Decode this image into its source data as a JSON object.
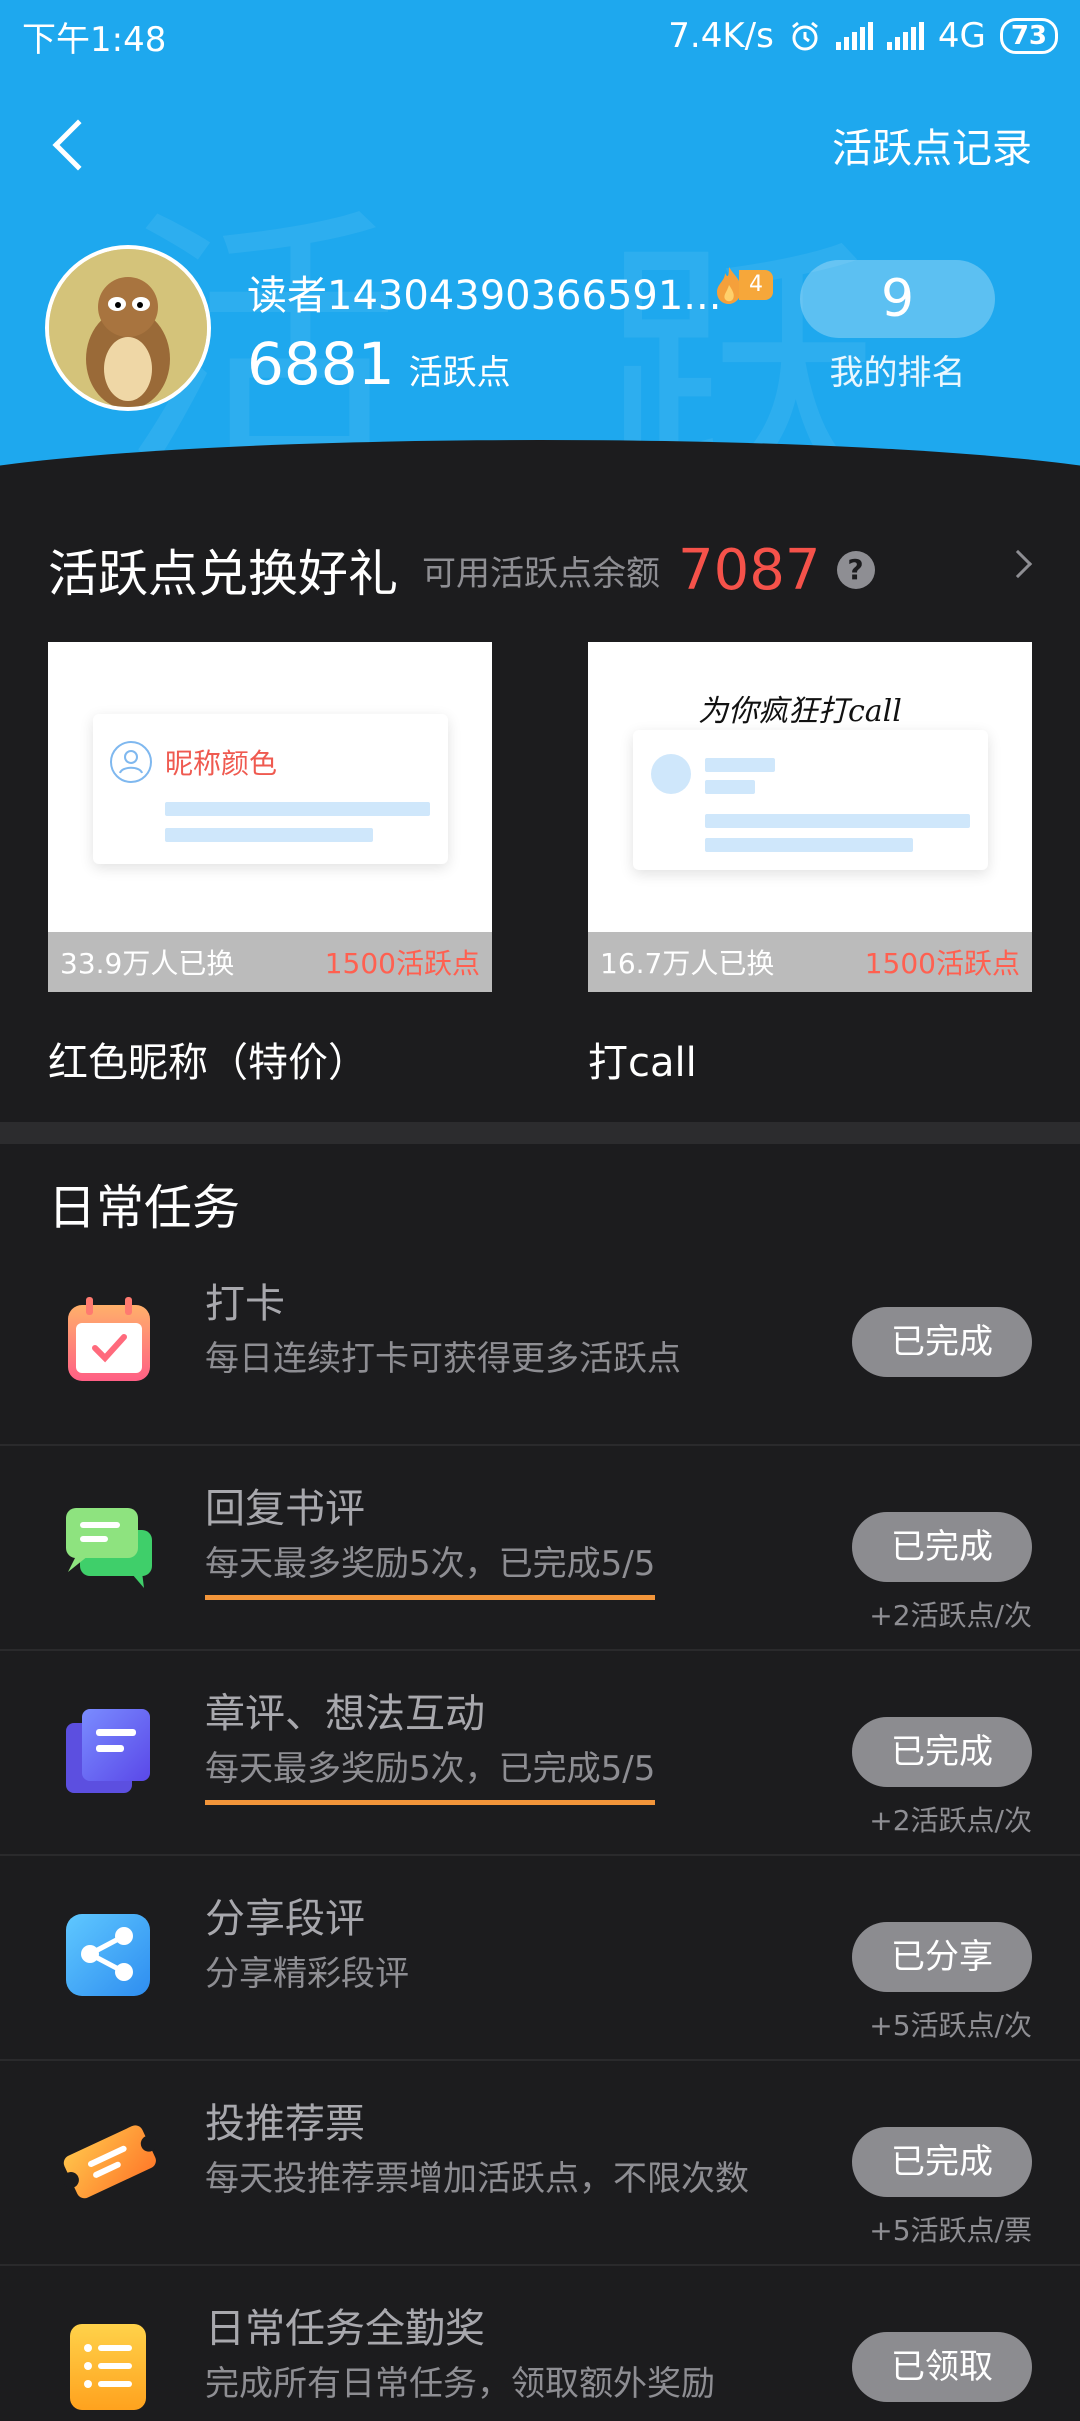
{
  "status_bar": {
    "time": "下午1:48",
    "speed": "7.4K/s",
    "network": "4G",
    "battery": "73"
  },
  "header": {
    "nav_title": "活跃点记录"
  },
  "profile": {
    "username": "读者14304390366591...",
    "level": "4",
    "points": "6881",
    "points_label": "活跃点",
    "rank": "9",
    "rank_label": "我的排名"
  },
  "exchange": {
    "title": "活跃点兑换好礼",
    "balance_label": "可用活跃点余额",
    "balance": "7087",
    "items": [
      {
        "name": "红色昵称（特价）",
        "exchanged": "33.9万人已换",
        "cost": "1500活跃点",
        "preview_text": "昵称颜色"
      },
      {
        "name": "打call",
        "exchanged": "16.7万人已换",
        "cost": "1500活跃点",
        "preview_text": "为你疯狂打call"
      }
    ]
  },
  "tasks": {
    "title": "日常任务",
    "items": [
      {
        "title": "打卡",
        "desc": "每日连续打卡可获得更多活跃点",
        "button": "已完成",
        "reward": ""
      },
      {
        "title": "回复书评",
        "desc": "每天最多奖励5次，已完成5/5",
        "button": "已完成",
        "reward": "+2活跃点/次"
      },
      {
        "title": "章评、想法互动",
        "desc": "每天最多奖励5次，已完成5/5",
        "button": "已完成",
        "reward": "+2活跃点/次"
      },
      {
        "title": "分享段评",
        "desc": "分享精彩段评",
        "button": "已分享",
        "reward": "+5活跃点/次"
      },
      {
        "title": "投推荐票",
        "desc": "每天投推荐票增加活跃点，不限次数",
        "button": "已完成",
        "reward": "+5活跃点/票"
      },
      {
        "title": "日常任务全勤奖",
        "desc": "完成所有日常任务，领取额外奖励",
        "button": "已领取",
        "reward": ""
      }
    ]
  },
  "colors": {
    "header_blue": "#1ea8ee",
    "balance_red": "#f5524a",
    "underline_orange": "#f2953a",
    "background": "#1c1c1e"
  },
  "icons": [
    "back-icon",
    "alarm-icon",
    "signal-icon",
    "battery-icon",
    "flame-icon",
    "help-icon",
    "chevron-right-icon",
    "calendar-check-icon",
    "chat-bubbles-icon",
    "document-icon",
    "share-icon",
    "ticket-icon",
    "list-icon"
  ]
}
